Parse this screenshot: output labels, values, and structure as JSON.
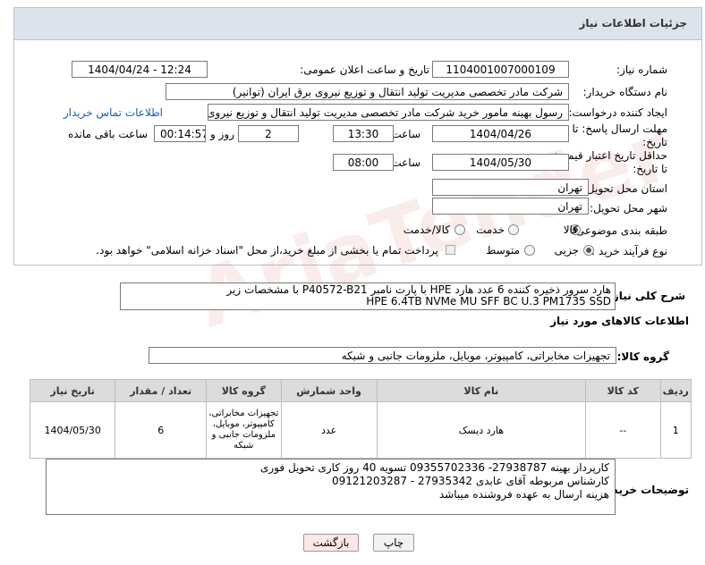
{
  "header": {
    "title": "جزئیات اطلاعات نیاز"
  },
  "fields": {
    "need_number_label": "شماره نیاز:",
    "need_number": "1104001007000109",
    "announce_label": "تاریخ و ساعت اعلان عمومی:",
    "announce_value": "1404/04/24 - 12:24",
    "buyer_org_label": "نام دستگاه خریدار:",
    "buyer_org": "شرکت مادر تخصصی مدیریت تولید  انتقال و توزیع نیروی برق ایران (توانیر)",
    "creator_label": "ایجاد کننده درخواست:",
    "creator": "رسول بهینه مامور خرید شرکت مادر تخصصی مدیریت تولید  انتقال و توزیع نیروی",
    "contact_link": "اطلاعات تماس خریدار",
    "reply_deadline_label": "مهلت ارسال پاسخ: تا تاریخ:",
    "reply_date": "1404/04/26",
    "time_label": "ساعت",
    "reply_time": "13:30",
    "days_value": "2",
    "days_label": "روز و",
    "remaining_time": "00:14:57",
    "remaining_label": "ساعت باقی مانده",
    "price_validity_label": "حداقل تاریخ اعتبار قیمت: تا تاریخ:",
    "price_date": "1404/05/30",
    "price_time": "08:00",
    "province_label": "استان محل تحویل:",
    "province": "تهران",
    "city_label": "شهر محل تحویل:",
    "city": "تهران",
    "category_label": "طبقه بندی موضوعی:",
    "category_options": [
      "کالا",
      "خدمت",
      "کالا/خدمت"
    ],
    "process_label": "نوع فرآیند خرید :",
    "process_options": [
      "جزیی",
      "متوسط"
    ],
    "payment_note": "پرداخت تمام یا بخشی از مبلغ خرید،از محل \"اسناد خزانه اسلامی\" خواهد بود."
  },
  "summary": {
    "label": "شرح کلی نیاز:",
    "line1": "هارد سرور ذخیره کننده 6 عدد هارد  HPE با پارت نامبر P40572-B21  با مشخصات زیر",
    "line2": "HPE 6.4TB NVMe MU SFF BC U.3 PM1735 SSD"
  },
  "goods": {
    "section_title": "اطلاعات کالاهای مورد نیاز",
    "group_label": "گروه کالا:",
    "group_value": "تجهیزات مخابراتی، کامپیوتر، موبایل، ملزومات جانبی و شبکه",
    "columns": [
      "ردیف",
      "کد کالا",
      "نام کالا",
      "واحد شمارش",
      "گروه کالا",
      "تعداد / مقدار",
      "تاریخ نیاز"
    ],
    "rows": [
      {
        "row": "1",
        "code": "--",
        "name": "هارد دیسک",
        "unit": "عدد",
        "group": "تجهیزات مخابراتی، کامپیوتر، موبایل، ملزومات جانبی و شبکه",
        "qty": "6",
        "date": "1404/05/30"
      }
    ]
  },
  "buyer_notes": {
    "label": "توضیحات خریدار:",
    "line1": "کارپرداز بهینه 27938787- 09355702336  تسویه 40 روز کاری   تحویل فوری",
    "line2": "کارشناس مربوطه آقای عابدی 27935342 - 09121203287",
    "line3": "هزینه ارسال به عهده فروشنده میباشد"
  },
  "buttons": {
    "print": "چاپ",
    "back": "بازگشت"
  },
  "colors": {
    "header_bg": "#dde3ec",
    "link": "#1a5fb4",
    "back_bg": "#fde8e8",
    "print_bg": "#f2f2f2"
  }
}
